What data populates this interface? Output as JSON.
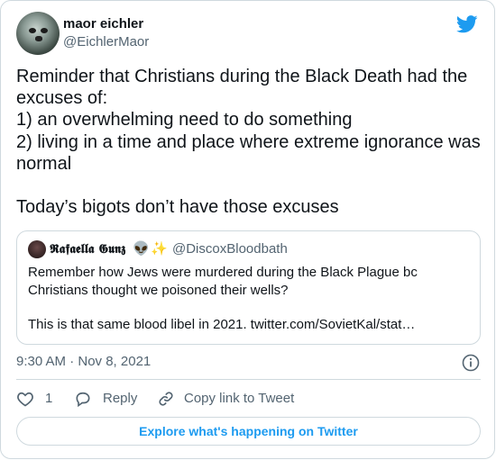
{
  "author": {
    "name": "maor eichler",
    "handle": "@EichlerMaor"
  },
  "tweet": {
    "lines": [
      "Reminder that Christians during the Black Death had the",
      "excuses of:",
      "1) an overwhelming need to do something",
      "2) living in a time and place where extreme ignorance was",
      "normal",
      "Today’s bigots don’t have those excuses"
    ]
  },
  "quoted": {
    "name": "𝕽𝖆𝖋𝖆𝖊𝖑𝖑𝖆 𝕲𝖚𝖓𝖟",
    "emoji1": "👽",
    "emoji2": "✨",
    "handle": "@DiscoxBloodbath",
    "lines": [
      "Remember how Jews were murdered during the Black Plague bc",
      "Christians thought we poisoned their wells?",
      "This is that same blood libel in 2021. twitter.com/SovietKal/stat…"
    ]
  },
  "meta": {
    "timestamp": "9:30 AM · Nov 8, 2021"
  },
  "actions": {
    "like_count": "1",
    "reply_label": "Reply",
    "copy_label": "Copy link to Tweet"
  },
  "explore_label": "Explore what's happening on Twitter",
  "colors": {
    "accent": "#1d9bf0",
    "secondary_text": "#536471",
    "border": "#cfd9de"
  }
}
